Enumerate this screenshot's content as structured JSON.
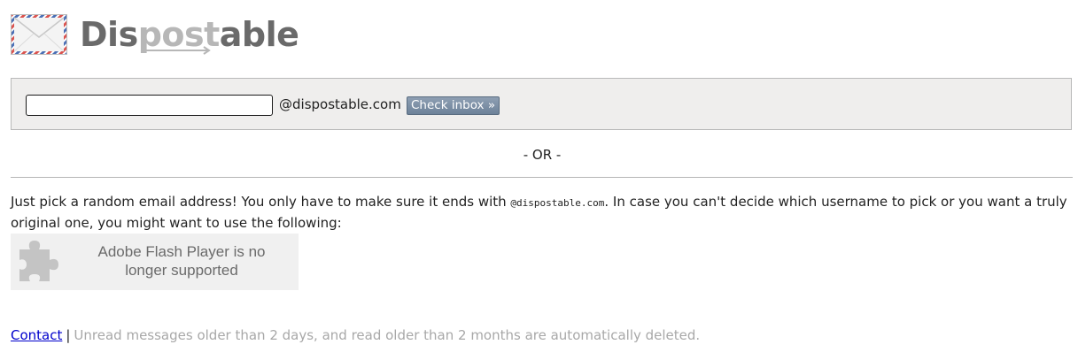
{
  "logo": {
    "text_start": "Dis",
    "text_mid": "post",
    "text_end": "able",
    "icon": "envelope-icon",
    "colors": {
      "dark": "#6a6a6a",
      "light": "#b7b7b7"
    }
  },
  "form": {
    "username_value": "",
    "domain": "@dispostable.com",
    "button_label": "Check inbox »"
  },
  "separator": "- OR -",
  "intro": {
    "text_before": "Just pick a random email address! You only have to make sure it ends with ",
    "code": "@dispostable.com",
    "text_after": ". In case you can't decide which username to pick or you want a truly original one, you might want to use the following:"
  },
  "plugin": {
    "icon": "puzzle-icon",
    "message": "Adobe Flash Player is no longer supported"
  },
  "footer": {
    "contact_label": "Contact",
    "divider": "|",
    "note": "Unread messages older than 2 days, and read older than 2 months are automatically deleted."
  }
}
